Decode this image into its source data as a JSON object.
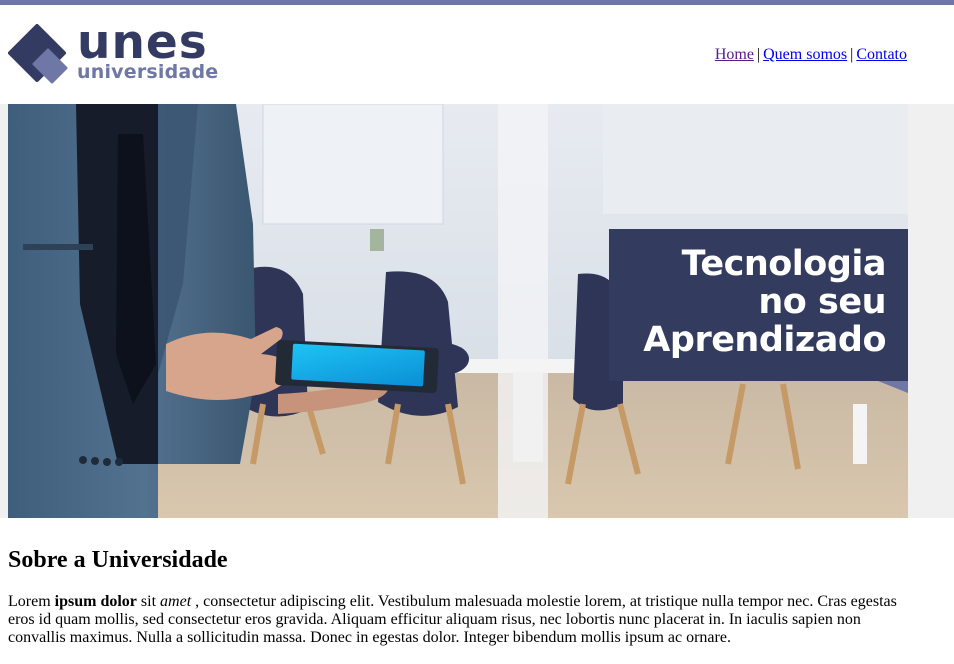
{
  "logo": {
    "word": "unes",
    "sub": "universidade"
  },
  "nav": {
    "items": [
      "Home",
      "Quem somos",
      "Contato"
    ],
    "separator": "|"
  },
  "banner": {
    "headline": [
      "Tecnologia",
      "no seu",
      "Aprendizado"
    ]
  },
  "content": {
    "title": "Sobre a Universidade",
    "paragraph": {
      "p1": "Lorem ",
      "bold": "ipsum dolor",
      "p2": " sit ",
      "italic": "amet",
      "p3": " , consectetur adipiscing elit. Vestibulum malesuada molestie lorem, at tristique nulla tempor nec. Cras egestas eros id quam mollis, sed consectetur eros gravida. Aliquam efficitur aliquam risus, nec lobortis nunc placerat in. In iaculis sapien non convallis maximus. Nulla a sollicitudin massa. Donec in egestas dolor. Integer bibendum mollis ipsum ac ornare."
    }
  },
  "colors": {
    "brand_dark": "#333b63",
    "brand_light": "#6f77a6",
    "link": "#0000ee",
    "visited_link": "#551a8b"
  }
}
